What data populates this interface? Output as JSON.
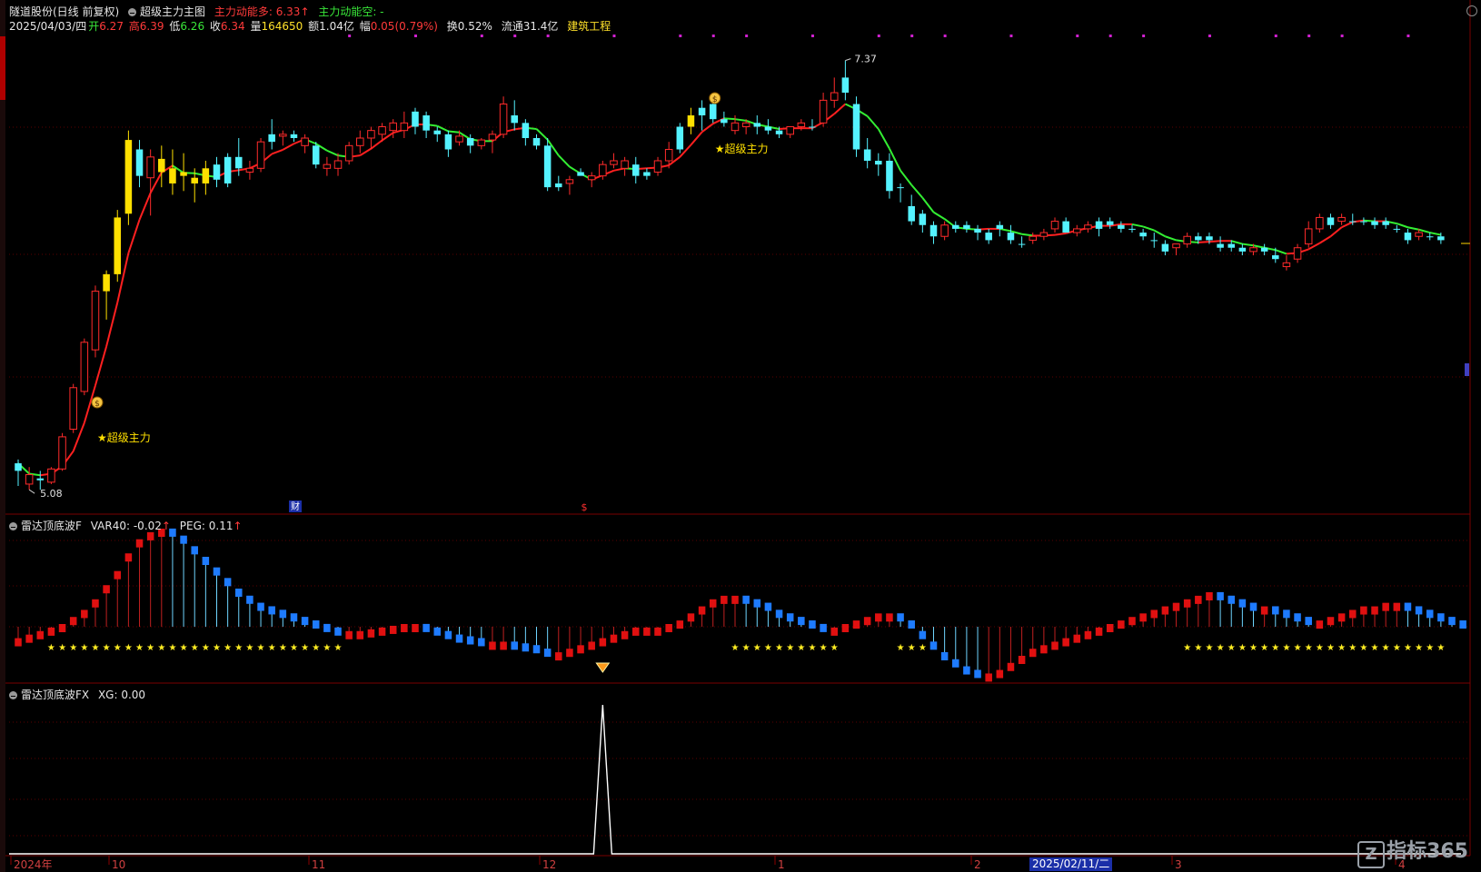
{
  "header": {
    "stock": "隧道股份(日线 前复权)",
    "indicator": "超级主力主图",
    "long_label": "主力动能多: 6.33",
    "long_arrow": "↑",
    "short_label": "主力动能空: -",
    "date": "2025/04/03/四",
    "open_label": "开",
    "open": "6.27",
    "high_label": "高",
    "high": "6.39",
    "low_label": "低",
    "low": "6.26",
    "close_label": "收",
    "close": "6.34",
    "vol_label": "量",
    "vol": "164650",
    "amt_label": "额",
    "amt": "1.04亿",
    "chg_label": "幅",
    "chg": "0.05(0.79%)",
    "turnover": "换0.52%",
    "float": "流通31.4亿",
    "sector": "建筑工程"
  },
  "panel2": {
    "title": "雷达顶底波F",
    "var40": "VAR40: -0.02",
    "var40_arrow": "↑",
    "peg": "PEG: 0.11",
    "peg_arrow": "↑"
  },
  "panel3": {
    "title": "雷达顶底波FX",
    "xg": "XG: 0.00"
  },
  "xaxis": {
    "labels": [
      "2024年",
      "10",
      "11",
      "12",
      "1",
      "2",
      "3",
      "4"
    ],
    "cursor_date": "2025/02/11/二"
  },
  "price_markers": {
    "max": "7.37",
    "min": "5.08"
  },
  "annotations": {
    "super1": "★超级主力",
    "super2": "★超级主力",
    "fin": "财",
    "dollar": "$"
  },
  "logo": "指标365",
  "colors": {
    "up": "#ff2b2b",
    "down": "#54f2ff",
    "yellow": "#ffe000",
    "ma_up": "#ff2020",
    "ma_down": "#33ee33",
    "wave_red": "#e01010",
    "wave_blue": "#1e7bff",
    "star": "#ffee22"
  },
  "chart_data": {
    "type": "candlestick",
    "ylim": [
      5.0,
      7.45
    ],
    "candles": [
      [
        5.2,
        5.26,
        5.12,
        5.24,
        "c"
      ],
      [
        5.18,
        5.22,
        5.1,
        5.13,
        "u"
      ],
      [
        5.15,
        5.2,
        5.1,
        5.16,
        "c"
      ],
      [
        5.14,
        5.22,
        5.13,
        5.21,
        "u"
      ],
      [
        5.21,
        5.4,
        5.2,
        5.38,
        "u"
      ],
      [
        5.42,
        5.66,
        5.4,
        5.64,
        "u"
      ],
      [
        5.62,
        5.9,
        5.6,
        5.88,
        "u"
      ],
      [
        5.84,
        6.18,
        5.8,
        6.15,
        "u"
      ],
      [
        6.15,
        6.26,
        6.0,
        6.24,
        "y"
      ],
      [
        6.24,
        6.58,
        6.2,
        6.54,
        "y"
      ],
      [
        6.56,
        7.0,
        6.5,
        6.95,
        "y"
      ],
      [
        6.9,
        6.95,
        6.7,
        6.76,
        "c"
      ],
      [
        6.75,
        6.9,
        6.55,
        6.86,
        "u"
      ],
      [
        6.85,
        6.92,
        6.7,
        6.78,
        "y"
      ],
      [
        6.8,
        6.9,
        6.66,
        6.72,
        "y"
      ],
      [
        6.78,
        6.88,
        6.68,
        6.76,
        "y"
      ],
      [
        6.72,
        6.8,
        6.62,
        6.75,
        "y"
      ],
      [
        6.72,
        6.84,
        6.66,
        6.8,
        "y"
      ],
      [
        6.82,
        6.86,
        6.7,
        6.74,
        "c"
      ],
      [
        6.72,
        6.88,
        6.7,
        6.86,
        "c"
      ],
      [
        6.86,
        6.96,
        6.76,
        6.8,
        "c"
      ],
      [
        6.78,
        6.84,
        6.74,
        6.8,
        "u"
      ],
      [
        6.8,
        6.96,
        6.78,
        6.94,
        "u"
      ],
      [
        6.94,
        7.06,
        6.9,
        6.98,
        "c"
      ],
      [
        6.98,
        7.0,
        6.92,
        6.97,
        "u"
      ],
      [
        6.98,
        7.0,
        6.94,
        6.96,
        "c"
      ],
      [
        6.96,
        6.98,
        6.88,
        6.92,
        "u"
      ],
      [
        6.92,
        6.94,
        6.8,
        6.82,
        "c"
      ],
      [
        6.82,
        6.86,
        6.76,
        6.8,
        "u"
      ],
      [
        6.8,
        6.88,
        6.76,
        6.84,
        "u"
      ],
      [
        6.84,
        6.94,
        6.82,
        6.92,
        "u"
      ],
      [
        6.92,
        7.0,
        6.88,
        6.96,
        "u"
      ],
      [
        6.96,
        7.02,
        6.9,
        7.0,
        "u"
      ],
      [
        6.98,
        7.04,
        6.94,
        7.02,
        "u"
      ],
      [
        7.0,
        7.06,
        6.96,
        7.04,
        "u"
      ],
      [
        7.04,
        7.1,
        6.96,
        7.0,
        "u"
      ],
      [
        7.02,
        7.12,
        6.98,
        7.1,
        "c"
      ],
      [
        7.08,
        7.1,
        6.96,
        7.0,
        "c"
      ],
      [
        7.0,
        7.02,
        6.94,
        6.98,
        "c"
      ],
      [
        6.98,
        7.0,
        6.86,
        6.9,
        "c"
      ],
      [
        6.94,
        7.0,
        6.92,
        6.97,
        "u"
      ],
      [
        6.96,
        6.98,
        6.88,
        6.92,
        "c"
      ],
      [
        6.92,
        6.96,
        6.9,
        6.95,
        "u"
      ],
      [
        6.95,
        7.0,
        6.88,
        6.98,
        "u"
      ],
      [
        6.98,
        7.18,
        6.96,
        7.14,
        "u"
      ],
      [
        7.08,
        7.16,
        7.0,
        7.04,
        "c"
      ],
      [
        7.04,
        7.06,
        6.92,
        6.96,
        "c"
      ],
      [
        6.96,
        6.98,
        6.9,
        6.92,
        "c"
      ],
      [
        6.92,
        6.96,
        6.68,
        6.7,
        "c"
      ],
      [
        6.7,
        6.76,
        6.68,
        6.72,
        "c"
      ],
      [
        6.72,
        6.76,
        6.66,
        6.74,
        "u"
      ],
      [
        6.76,
        6.8,
        6.78,
        6.78,
        "c"
      ],
      [
        6.74,
        6.78,
        6.7,
        6.76,
        "u"
      ],
      [
        6.76,
        6.84,
        6.74,
        6.82,
        "u"
      ],
      [
        6.82,
        6.88,
        6.8,
        6.84,
        "u"
      ],
      [
        6.84,
        6.86,
        6.76,
        6.8,
        "u"
      ],
      [
        6.82,
        6.86,
        6.72,
        6.76,
        "c"
      ],
      [
        6.76,
        6.8,
        6.74,
        6.78,
        "c"
      ],
      [
        6.78,
        6.86,
        6.76,
        6.84,
        "u"
      ],
      [
        6.84,
        6.94,
        6.8,
        6.9,
        "u"
      ],
      [
        6.9,
        7.04,
        6.88,
        7.02,
        "c"
      ],
      [
        7.02,
        7.12,
        6.98,
        7.08,
        "y"
      ],
      [
        7.08,
        7.16,
        7.0,
        7.12,
        "c"
      ],
      [
        7.14,
        7.16,
        7.04,
        7.06,
        "c"
      ],
      [
        7.06,
        7.1,
        7.02,
        7.04,
        "c"
      ],
      [
        7.04,
        7.08,
        6.98,
        7.0,
        "u"
      ],
      [
        7.02,
        7.06,
        6.98,
        7.04,
        "u"
      ],
      [
        7.04,
        7.08,
        6.98,
        7.02,
        "c"
      ],
      [
        7.02,
        7.06,
        6.98,
        7.0,
        "c"
      ],
      [
        7.0,
        7.02,
        6.96,
        6.98,
        "c"
      ],
      [
        6.98,
        7.02,
        6.96,
        7.02,
        "u"
      ],
      [
        7.02,
        7.06,
        7.0,
        7.04,
        "u"
      ],
      [
        7.02,
        7.06,
        7.0,
        7.02,
        "c"
      ],
      [
        7.04,
        7.2,
        7.02,
        7.16,
        "u"
      ],
      [
        7.16,
        7.28,
        7.12,
        7.2,
        "u"
      ],
      [
        7.2,
        7.37,
        7.16,
        7.28,
        "c"
      ],
      [
        7.14,
        7.18,
        6.86,
        6.9,
        "c"
      ],
      [
        6.9,
        6.96,
        6.8,
        6.84,
        "c"
      ],
      [
        6.84,
        6.88,
        6.76,
        6.82,
        "c"
      ],
      [
        6.84,
        6.88,
        6.64,
        6.68,
        "c"
      ],
      [
        6.7,
        6.72,
        6.62,
        6.7,
        "c"
      ],
      [
        6.6,
        6.66,
        6.5,
        6.52,
        "c"
      ],
      [
        6.56,
        6.58,
        6.46,
        6.5,
        "c"
      ],
      [
        6.5,
        6.52,
        6.4,
        6.44,
        "c"
      ],
      [
        6.44,
        6.52,
        6.42,
        6.5,
        "u"
      ],
      [
        6.5,
        6.52,
        6.46,
        6.48,
        "c"
      ],
      [
        6.5,
        6.52,
        6.46,
        6.48,
        "c"
      ],
      [
        6.46,
        6.5,
        6.42,
        6.48,
        "c"
      ],
      [
        6.42,
        6.48,
        6.4,
        6.46,
        "c"
      ],
      [
        6.48,
        6.52,
        6.44,
        6.5,
        "c"
      ],
      [
        6.46,
        6.5,
        6.4,
        6.42,
        "c"
      ],
      [
        6.4,
        6.44,
        6.38,
        6.4,
        "c"
      ],
      [
        6.42,
        6.46,
        6.4,
        6.44,
        "u"
      ],
      [
        6.44,
        6.48,
        6.42,
        6.46,
        "u"
      ],
      [
        6.48,
        6.54,
        6.46,
        6.52,
        "u"
      ],
      [
        6.52,
        6.54,
        6.46,
        6.46,
        "c"
      ],
      [
        6.46,
        6.5,
        6.44,
        6.48,
        "u"
      ],
      [
        6.48,
        6.52,
        6.46,
        6.5,
        "u"
      ],
      [
        6.48,
        6.54,
        6.44,
        6.52,
        "c"
      ],
      [
        6.5,
        6.54,
        6.48,
        6.52,
        "c"
      ],
      [
        6.48,
        6.52,
        6.46,
        6.5,
        "c"
      ],
      [
        6.48,
        6.5,
        6.46,
        6.48,
        "c"
      ],
      [
        6.46,
        6.48,
        6.42,
        6.44,
        "c"
      ],
      [
        6.42,
        6.46,
        6.38,
        6.42,
        "c"
      ],
      [
        6.4,
        6.42,
        6.34,
        6.36,
        "c"
      ],
      [
        6.38,
        6.4,
        6.34,
        6.4,
        "u"
      ],
      [
        6.4,
        6.46,
        6.38,
        6.44,
        "u"
      ],
      [
        6.44,
        6.46,
        6.4,
        6.42,
        "c"
      ],
      [
        6.42,
        6.46,
        6.4,
        6.44,
        "c"
      ],
      [
        6.4,
        6.44,
        6.36,
        6.38,
        "c"
      ],
      [
        6.38,
        6.42,
        6.36,
        6.4,
        "c"
      ],
      [
        6.38,
        6.4,
        6.34,
        6.36,
        "c"
      ],
      [
        6.36,
        6.4,
        6.34,
        6.38,
        "u"
      ],
      [
        6.36,
        6.4,
        6.34,
        6.38,
        "c"
      ],
      [
        6.34,
        6.38,
        6.3,
        6.32,
        "c"
      ],
      [
        6.28,
        6.34,
        6.26,
        6.3,
        "u"
      ],
      [
        6.32,
        6.4,
        6.3,
        6.38,
        "u"
      ],
      [
        6.4,
        6.52,
        6.38,
        6.48,
        "u"
      ],
      [
        6.48,
        6.56,
        6.46,
        6.54,
        "u"
      ],
      [
        6.54,
        6.56,
        6.48,
        6.5,
        "c"
      ],
      [
        6.52,
        6.56,
        6.5,
        6.54,
        "u"
      ],
      [
        6.52,
        6.56,
        6.5,
        6.52,
        "c"
      ],
      [
        6.52,
        6.54,
        6.5,
        6.52,
        "c"
      ],
      [
        6.5,
        6.54,
        6.48,
        6.52,
        "c"
      ],
      [
        6.52,
        6.54,
        6.48,
        6.5,
        "c"
      ],
      [
        6.48,
        6.5,
        6.46,
        6.48,
        "c"
      ],
      [
        6.46,
        6.48,
        6.4,
        6.42,
        "c"
      ],
      [
        6.44,
        6.48,
        6.42,
        6.46,
        "u"
      ],
      [
        6.44,
        6.46,
        6.42,
        6.44,
        "c"
      ],
      [
        6.42,
        6.46,
        6.4,
        6.44,
        "c"
      ]
    ],
    "wave": [
      -0.08,
      -0.06,
      -0.04,
      -0.02,
      0.0,
      0.04,
      0.08,
      0.14,
      0.22,
      0.3,
      0.4,
      0.48,
      0.52,
      0.54,
      0.52,
      0.48,
      0.42,
      0.36,
      0.3,
      0.24,
      0.18,
      0.14,
      0.1,
      0.08,
      0.06,
      0.04,
      0.02,
      0.0,
      -0.02,
      -0.04,
      -0.04,
      -0.04,
      -0.03,
      -0.02,
      -0.01,
      0.0,
      0.0,
      -0.02,
      -0.04,
      -0.06,
      -0.08,
      -0.09,
      -0.1,
      -0.1,
      -0.1,
      -0.12,
      -0.13,
      -0.14,
      -0.16,
      -0.16,
      -0.14,
      -0.12,
      -0.1,
      -0.08,
      -0.06,
      -0.04,
      -0.02,
      -0.02,
      -0.02,
      0.0,
      0.02,
      0.06,
      0.1,
      0.14,
      0.16,
      0.16,
      0.14,
      0.12,
      0.1,
      0.06,
      0.04,
      0.02,
      0.0,
      -0.02,
      -0.02,
      0.0,
      0.02,
      0.04,
      0.06,
      0.06,
      0.04,
      0.0,
      -0.06,
      -0.12,
      -0.18,
      -0.22,
      -0.26,
      -0.28,
      -0.28,
      -0.26,
      -0.22,
      -0.18,
      -0.14,
      -0.12,
      -0.1,
      -0.08,
      -0.06,
      -0.04,
      -0.02,
      0.0,
      0.02,
      0.04,
      0.06,
      0.08,
      0.1,
      0.12,
      0.14,
      0.16,
      0.18,
      0.16,
      0.14,
      0.12,
      0.1,
      0.1,
      0.08,
      0.06,
      0.04,
      0.02,
      0.02,
      0.04,
      0.06,
      0.08,
      0.1,
      0.1,
      0.12,
      0.12,
      0.1,
      0.08,
      0.06,
      0.04,
      0.02,
      0.0
    ],
    "fx_spike_index": 53
  }
}
